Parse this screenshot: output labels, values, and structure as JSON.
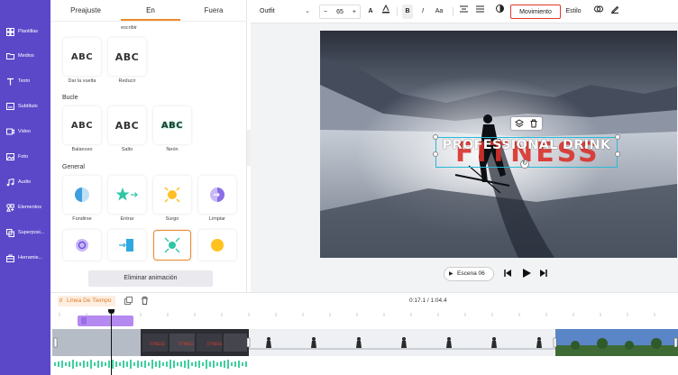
{
  "nav": {
    "items": [
      {
        "label": "Plantillas",
        "icon": "template-icon"
      },
      {
        "label": "Medios",
        "icon": "folder-icon"
      },
      {
        "label": "Texto",
        "icon": "text-icon"
      },
      {
        "label": "Subtítulo",
        "icon": "subtitle-icon"
      },
      {
        "label": "Video",
        "icon": "video-icon"
      },
      {
        "label": "Foto",
        "icon": "photo-icon"
      },
      {
        "label": "Audio",
        "icon": "music-icon"
      },
      {
        "label": "Elementos",
        "icon": "elements-icon"
      },
      {
        "label": "Superposi...",
        "icon": "overlay-icon"
      },
      {
        "label": "Herramie...",
        "icon": "toolbox-icon"
      }
    ]
  },
  "panel": {
    "tabs": [
      "Preajuste",
      "En",
      "Fuera"
    ],
    "active_tab": "En",
    "top_caption": "escribir",
    "top_cards": [
      {
        "glyph": "ABC",
        "label": "Dar la vuelta"
      },
      {
        "glyph": "ABC",
        "label": "Reducir"
      }
    ],
    "sections": [
      {
        "title": "Bucle",
        "cards": [
          {
            "glyph": "ABC",
            "label": "Balanceo"
          },
          {
            "glyph": "ABC",
            "label": "Salto"
          },
          {
            "glyph": "ABC",
            "label": "Neón"
          }
        ]
      },
      {
        "title": "General",
        "cards": [
          {
            "label": "Fundirse"
          },
          {
            "label": "Entrar"
          },
          {
            "label": "Surgo"
          },
          {
            "label": "Limpiar"
          }
        ]
      }
    ],
    "remove_button": "Eliminar animación"
  },
  "toolbar": {
    "font": "Outfit",
    "size": "65",
    "minus": "−",
    "plus": "+",
    "bold": "B",
    "italic": "I",
    "case": "Aa",
    "motion_tab": "Movimiento",
    "style_tab": "Estilo"
  },
  "video": {
    "text": "PROFESSIONAL DRINK",
    "bg_text": "FITNESS"
  },
  "player": {
    "scene": "Escena 06"
  },
  "timeline": {
    "badge": "Línea De Tiempo",
    "time": "0:17.1 / 1:04.4"
  },
  "colors": {
    "nav_bg": "#5b48c9",
    "accent_orange": "#f08a2a",
    "highlight_red": "#e23a2e",
    "clip_purple": "#b58af0",
    "audio_green": "#3ecfa0"
  }
}
